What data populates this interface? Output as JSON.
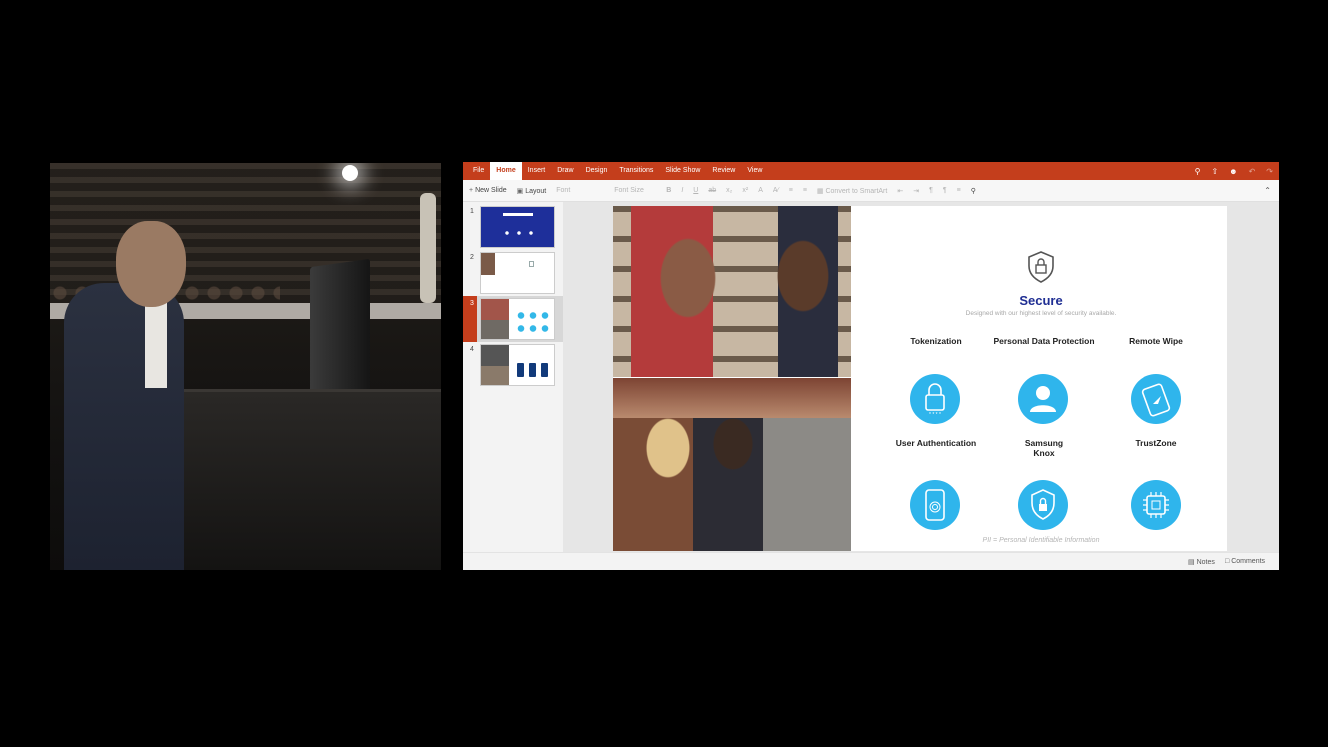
{
  "menu": {
    "tabs": [
      "File",
      "Home",
      "Insert",
      "Draw",
      "Design",
      "Transitions",
      "Slide Show",
      "Review",
      "View"
    ],
    "active_tab": "Home",
    "icons": [
      "lightbulb-icon",
      "share-icon",
      "person-icon",
      "undo-icon",
      "redo-icon"
    ]
  },
  "ribbon": {
    "new_slide": "New Slide",
    "layout": "Layout",
    "font": "Font",
    "font_size": "Font Size",
    "bold": "B",
    "italic": "I",
    "underline": "U",
    "strike": "ab",
    "convert": "Convert to SmartArt"
  },
  "thumbnails": [
    "1",
    "2",
    "3",
    "4"
  ],
  "selected_thumbnail": "3",
  "slide": {
    "title": "Secure",
    "subtitle": "Designed with our highest level of security available.",
    "features": [
      {
        "label": "Tokenization",
        "icon": "lock-code-icon"
      },
      {
        "label": "Personal Data Protection",
        "icon": "user-profile-icon"
      },
      {
        "label": "Remote Wipe",
        "icon": "phone-wipe-icon"
      },
      {
        "label": "User Authentication",
        "icon": "fingerprint-phone-icon"
      },
      {
        "label": "Samsung Knox",
        "icon": "knox-shield-icon"
      },
      {
        "label": "TrustZone",
        "icon": "chip-icon"
      }
    ],
    "footnote": "PII = Personal Identifiable Information"
  },
  "status": {
    "notes": "Notes",
    "comments": "Comments"
  },
  "colors": {
    "accent": "#c43e1c",
    "title": "#1f2e93",
    "icon_circle": "#2fb5ec"
  }
}
